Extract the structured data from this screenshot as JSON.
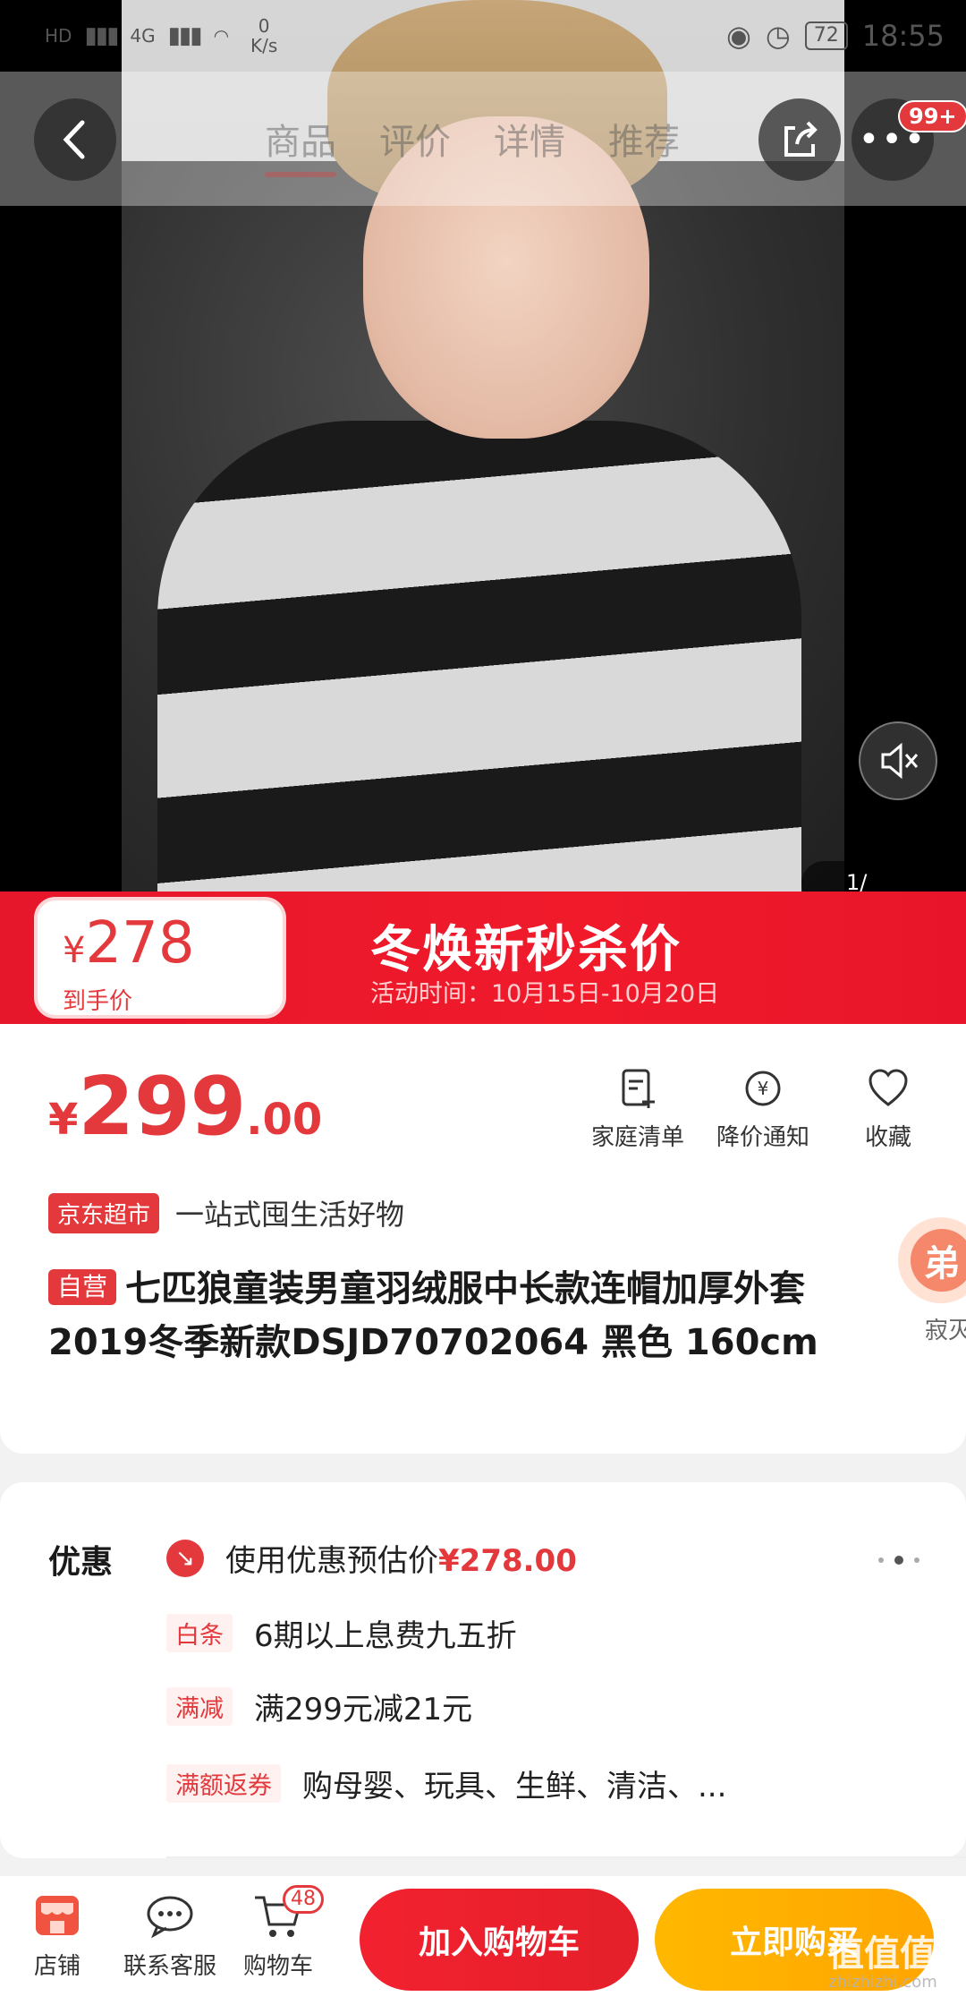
{
  "statusbar": {
    "net_label": "HD",
    "net_gen": "4G",
    "speed_value": "0",
    "speed_unit": "K/s",
    "battery": "72",
    "time": "18:55"
  },
  "nav": {
    "tabs": [
      "商品",
      "评价",
      "详情",
      "推荐"
    ],
    "more_badge": "99+"
  },
  "media": {
    "page_indicator": "1/"
  },
  "promo": {
    "currency": "¥",
    "price": "278",
    "price_label": "到手价",
    "title": "冬焕新秒杀价",
    "time": "活动时间：10月15日-10月20日"
  },
  "product": {
    "currency": "¥",
    "price_int": "299",
    "price_dec": ".00",
    "actions": [
      "家庭清单",
      "降价通知",
      "收藏"
    ],
    "store_tag": "京东超市",
    "store_slogan": "一站式囤生活好物",
    "self_tag": "自营",
    "title": "七匹狼童装男童羽绒服中长款连帽加厚外套2019冬季新款DSJD70702064  黑色 160cm"
  },
  "float_bubble": {
    "char": "弟",
    "label": "寂灭"
  },
  "coupons": {
    "heading": "优惠",
    "estimate_text": "使用优惠预估价",
    "estimate_price": "¥278.00",
    "rows": [
      {
        "tag": "白条",
        "text": "6期以上息费九五折"
      },
      {
        "tag": "满减",
        "text": "满299元减21元"
      },
      {
        "tag": "满额返券",
        "text": "购母婴、玩具、生鲜、清洁、..."
      }
    ]
  },
  "bottom": {
    "store": "店铺",
    "service": "联系客服",
    "cart": "购物车",
    "cart_count": "48",
    "add_to_cart": "加入购物车",
    "buy_now": "立即购买"
  },
  "watermark": {
    "logo": "值值值",
    "site": "zhizhizhi.com"
  },
  "colors": {
    "brand_red": "#e4393c",
    "buy_orange": "#ffb800"
  }
}
